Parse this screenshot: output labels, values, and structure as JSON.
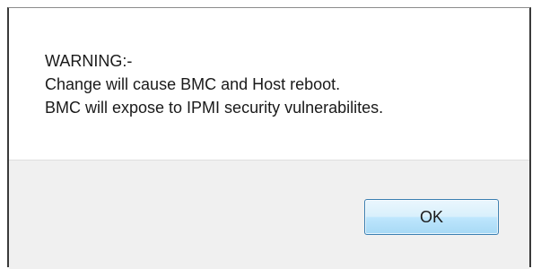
{
  "dialog": {
    "message_lines": [
      "WARNING:-",
      "Change will cause BMC and Host reboot.",
      "BMC will expose to IPMI security vulnerabilites."
    ],
    "ok_label": "OK"
  },
  "colors": {
    "button_border": "#3c7fb1",
    "button_area_bg": "#f0f0f0",
    "message_bg": "#ffffff"
  }
}
